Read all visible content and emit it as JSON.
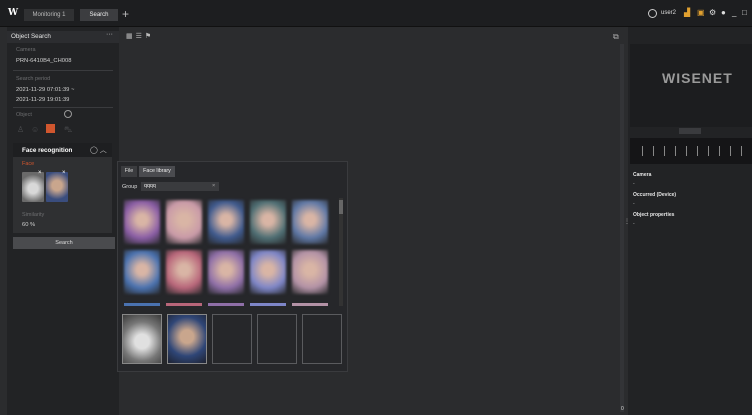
{
  "app": {
    "logo": "W",
    "tabs": [
      {
        "label": "Monitoring 1"
      },
      {
        "label": "Search"
      }
    ],
    "add_tab": "+",
    "user": "user2"
  },
  "object_search": {
    "title": "Object Search",
    "more": "···",
    "camera_label": "Camera",
    "camera_value": "PRN-6410B4_CH008",
    "period_label": "Search period",
    "period_start": "2021-11-29 07:01:39 ~",
    "period_end": "2021-11-29 19:01:39",
    "object_label": "Object",
    "face_recognition": {
      "title": "Face recognition",
      "face_label": "Face",
      "similarity_label": "Similarity",
      "similarity_value": "60 %"
    },
    "search_button": "Search"
  },
  "popup": {
    "tabs": [
      "File",
      "Face library"
    ],
    "group_label": "Group",
    "group_value": "qqqq",
    "group_clear": "×",
    "library_colors": [
      "#8b5ea6",
      "#c99aa8",
      "#3f5a8e",
      "#4f6f74",
      "#5f78a6",
      "#4a72b0",
      "#b8667a",
      "#8f6fa8",
      "#7e86c8",
      "#b392a6"
    ],
    "selected_count": 2,
    "empty_slots": 3
  },
  "right_panel": {
    "brand": "WISENET",
    "camera_label": "Camera",
    "camera_value": "-",
    "occurred_label": "Occurred (Device)",
    "occurred_value": "-",
    "props_label": "Object properties",
    "props_value": "-"
  },
  "misc": {
    "zero": "0"
  }
}
